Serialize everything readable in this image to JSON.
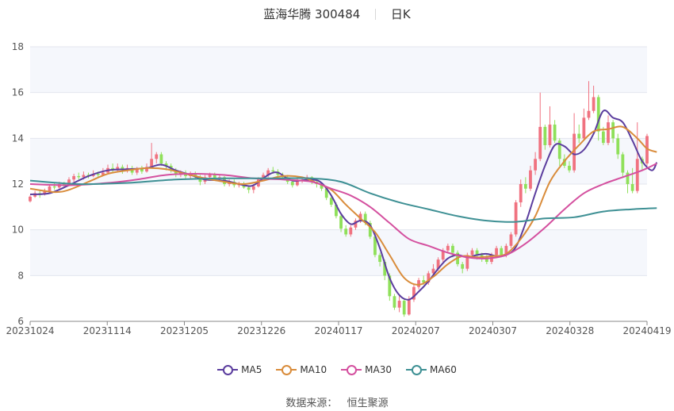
{
  "title": {
    "stock": "蓝海华腾 300484",
    "period": "日K"
  },
  "source": {
    "label": "数据来源：",
    "value": "恒生聚源"
  },
  "chart_data": {
    "type": "candlestick",
    "ylim": [
      6,
      18
    ],
    "yticks": [
      6,
      8,
      10,
      12,
      14,
      16,
      18
    ],
    "xticks": [
      "20231024",
      "20231114",
      "20231205",
      "20231226",
      "20240117",
      "20240207",
      "20240307",
      "20240328",
      "20240419"
    ],
    "grid": "horizontal",
    "legend_position": "bottom",
    "colors": {
      "up": "#f07280",
      "down": "#8fe05a",
      "ma5": "#5b3d9e",
      "ma10": "#d98c3b",
      "ma30": "#d4509f",
      "ma60": "#3e9094"
    },
    "candles": [
      [
        11.25,
        11.45,
        11.5,
        11.2
      ],
      [
        11.45,
        11.6,
        11.7,
        11.4
      ],
      [
        11.6,
        11.55,
        11.75,
        11.4
      ],
      [
        11.55,
        11.7,
        11.8,
        11.5
      ],
      [
        11.7,
        11.9,
        12.0,
        11.65
      ],
      [
        11.9,
        11.85,
        12.05,
        11.75
      ],
      [
        11.85,
        12.0,
        12.1,
        11.8
      ],
      [
        12.0,
        11.95,
        12.1,
        11.85
      ],
      [
        11.95,
        12.2,
        12.3,
        11.9
      ],
      [
        12.2,
        12.35,
        12.45,
        12.1
      ],
      [
        12.35,
        12.3,
        12.5,
        12.2
      ],
      [
        12.3,
        12.4,
        12.55,
        12.2
      ],
      [
        12.4,
        12.35,
        12.5,
        12.25
      ],
      [
        12.35,
        12.45,
        12.6,
        12.3
      ],
      [
        12.45,
        12.4,
        12.55,
        12.3
      ],
      [
        12.4,
        12.5,
        12.7,
        12.35
      ],
      [
        12.5,
        12.7,
        12.85,
        12.45
      ],
      [
        12.7,
        12.6,
        12.9,
        12.5
      ],
      [
        12.6,
        12.75,
        12.9,
        12.55
      ],
      [
        12.75,
        12.6,
        12.85,
        12.45
      ],
      [
        12.6,
        12.7,
        12.85,
        12.5
      ],
      [
        12.7,
        12.5,
        12.8,
        12.4
      ],
      [
        12.5,
        12.65,
        12.75,
        12.4
      ],
      [
        12.65,
        12.55,
        12.8,
        12.45
      ],
      [
        12.55,
        12.75,
        12.9,
        12.5
      ],
      [
        12.75,
        13.1,
        13.8,
        12.7
      ],
      [
        13.1,
        13.3,
        13.4,
        12.9
      ],
      [
        13.3,
        12.9,
        13.4,
        12.8
      ],
      [
        12.9,
        12.8,
        13.0,
        12.6
      ],
      [
        12.8,
        12.6,
        12.9,
        12.5
      ],
      [
        12.6,
        12.4,
        12.7,
        12.3
      ],
      [
        12.4,
        12.5,
        12.6,
        12.3
      ],
      [
        12.5,
        12.35,
        12.6,
        12.2
      ],
      [
        12.35,
        12.45,
        12.55,
        12.25
      ],
      [
        12.45,
        12.3,
        12.55,
        12.2
      ],
      [
        12.3,
        12.1,
        12.4,
        11.95
      ],
      [
        12.1,
        12.3,
        12.4,
        12.0
      ],
      [
        12.3,
        12.4,
        12.5,
        12.2
      ],
      [
        12.4,
        12.25,
        12.5,
        12.15
      ],
      [
        12.25,
        12.3,
        12.4,
        12.1
      ],
      [
        12.3,
        12.0,
        12.35,
        11.9
      ],
      [
        12.0,
        12.1,
        12.2,
        11.9
      ],
      [
        12.1,
        11.95,
        12.2,
        11.85
      ],
      [
        11.95,
        12.0,
        12.1,
        11.85
      ],
      [
        12.0,
        11.85,
        12.1,
        11.8
      ],
      [
        11.85,
        11.75,
        11.95,
        11.6
      ],
      [
        11.75,
        11.9,
        12.0,
        11.6
      ],
      [
        11.9,
        12.2,
        12.3,
        11.85
      ],
      [
        12.2,
        12.4,
        12.5,
        12.15
      ],
      [
        12.4,
        12.6,
        12.7,
        12.3
      ],
      [
        12.6,
        12.55,
        12.75,
        12.45
      ],
      [
        12.55,
        12.4,
        12.65,
        12.3
      ],
      [
        12.4,
        12.3,
        12.5,
        12.2
      ],
      [
        12.3,
        12.1,
        12.4,
        12.0
      ],
      [
        12.1,
        11.95,
        12.2,
        11.85
      ],
      [
        11.95,
        12.15,
        12.25,
        11.9
      ],
      [
        12.15,
        12.2,
        12.3,
        12.05
      ],
      [
        12.2,
        12.3,
        12.4,
        12.1
      ],
      [
        12.3,
        12.1,
        12.35,
        12.0
      ],
      [
        12.1,
        12.0,
        12.2,
        11.85
      ],
      [
        12.0,
        11.8,
        12.05,
        11.7
      ],
      [
        11.8,
        11.4,
        11.85,
        11.3
      ],
      [
        11.4,
        11.1,
        11.5,
        11.0
      ],
      [
        11.1,
        10.6,
        11.2,
        10.5
      ],
      [
        10.6,
        10.05,
        10.7,
        9.9
      ],
      [
        10.05,
        9.8,
        10.2,
        9.7
      ],
      [
        9.8,
        10.1,
        10.2,
        9.7
      ],
      [
        10.1,
        10.4,
        10.5,
        10.0
      ],
      [
        10.4,
        10.7,
        10.8,
        10.3
      ],
      [
        10.7,
        10.3,
        10.8,
        10.2
      ],
      [
        10.3,
        9.7,
        10.4,
        9.6
      ],
      [
        9.7,
        8.9,
        9.8,
        8.8
      ],
      [
        8.9,
        8.6,
        9.0,
        8.4
      ],
      [
        8.6,
        8.0,
        8.7,
        7.8
      ],
      [
        8.0,
        7.1,
        8.1,
        6.9
      ],
      [
        7.1,
        6.6,
        7.2,
        6.5
      ],
      [
        6.6,
        6.9,
        7.1,
        6.4
      ],
      [
        6.9,
        6.3,
        7.0,
        6.2
      ],
      [
        6.3,
        6.95,
        7.1,
        6.25
      ],
      [
        6.95,
        7.5,
        7.6,
        6.85
      ],
      [
        7.5,
        7.8,
        7.9,
        7.4
      ],
      [
        7.8,
        7.7,
        8.0,
        7.6
      ],
      [
        7.7,
        8.1,
        8.2,
        7.6
      ],
      [
        8.1,
        8.3,
        8.5,
        8.0
      ],
      [
        8.3,
        8.7,
        8.8,
        8.2
      ],
      [
        8.7,
        9.1,
        9.2,
        8.6
      ],
      [
        9.1,
        9.3,
        9.4,
        9.0
      ],
      [
        9.3,
        9.0,
        9.4,
        8.8
      ],
      [
        9.0,
        8.5,
        9.1,
        8.4
      ],
      [
        8.5,
        8.3,
        8.6,
        8.1
      ],
      [
        8.3,
        8.9,
        9.0,
        8.2
      ],
      [
        8.9,
        9.1,
        9.2,
        8.8
      ],
      [
        9.1,
        8.9,
        9.2,
        8.7
      ],
      [
        8.9,
        8.8,
        9.0,
        8.6
      ],
      [
        8.8,
        8.6,
        8.9,
        8.5
      ],
      [
        8.6,
        8.9,
        9.0,
        8.5
      ],
      [
        8.9,
        9.2,
        9.3,
        8.8
      ],
      [
        9.2,
        8.9,
        9.3,
        8.8
      ],
      [
        8.9,
        9.3,
        9.4,
        8.8
      ],
      [
        9.3,
        9.8,
        9.9,
        9.2
      ],
      [
        9.8,
        11.2,
        11.3,
        9.7
      ],
      [
        11.2,
        12.0,
        12.2,
        11.0
      ],
      [
        12.0,
        11.8,
        12.3,
        11.6
      ],
      [
        11.8,
        12.6,
        12.8,
        11.7
      ],
      [
        12.6,
        13.1,
        13.4,
        12.4
      ],
      [
        13.1,
        14.5,
        16.0,
        13.0
      ],
      [
        14.5,
        13.7,
        14.6,
        13.5
      ],
      [
        13.7,
        14.6,
        15.4,
        13.6
      ],
      [
        14.6,
        13.9,
        14.8,
        13.8
      ],
      [
        13.9,
        13.1,
        14.0,
        12.8
      ],
      [
        13.1,
        12.8,
        13.3,
        12.7
      ],
      [
        12.8,
        12.6,
        13.0,
        12.5
      ],
      [
        12.6,
        14.2,
        15.1,
        12.5
      ],
      [
        14.2,
        14.0,
        14.6,
        13.8
      ],
      [
        14.0,
        14.9,
        15.3,
        13.9
      ],
      [
        14.9,
        15.2,
        16.5,
        14.8
      ],
      [
        15.2,
        15.8,
        16.3,
        15.1
      ],
      [
        15.8,
        14.3,
        15.9,
        13.9
      ],
      [
        14.3,
        13.8,
        14.5,
        13.7
      ],
      [
        13.8,
        14.7,
        15.0,
        13.7
      ],
      [
        14.7,
        14.0,
        14.8,
        13.8
      ],
      [
        14.0,
        13.3,
        14.2,
        13.1
      ],
      [
        13.3,
        12.5,
        13.4,
        12.3
      ],
      [
        12.5,
        12.0,
        12.6,
        11.6
      ],
      [
        12.0,
        11.7,
        12.7,
        11.6
      ],
      [
        11.7,
        13.1,
        14.7,
        11.6
      ],
      [
        13.1,
        12.9,
        13.2,
        12.6
      ],
      [
        12.9,
        14.1,
        14.2,
        12.8
      ]
    ],
    "ma": [
      {
        "name": "MA5",
        "color": "#5b3d9e",
        "values": [
          [
            0,
            11.55
          ],
          [
            4,
            11.6
          ],
          [
            8,
            11.95
          ],
          [
            12,
            12.35
          ],
          [
            16,
            12.6
          ],
          [
            20,
            12.65
          ],
          [
            24,
            12.7
          ],
          [
            27,
            12.85
          ],
          [
            30,
            12.6
          ],
          [
            33,
            12.4
          ],
          [
            36,
            12.2
          ],
          [
            40,
            12.15
          ],
          [
            44,
            11.95
          ],
          [
            46,
            11.95
          ],
          [
            49,
            12.4
          ],
          [
            51,
            12.5
          ],
          [
            54,
            12.15
          ],
          [
            58,
            12.2
          ],
          [
            60,
            12.05
          ],
          [
            62,
            11.5
          ],
          [
            64,
            10.7
          ],
          [
            66,
            10.25
          ],
          [
            68,
            10.4
          ],
          [
            70,
            10.2
          ],
          [
            72,
            9.2
          ],
          [
            74,
            7.9
          ],
          [
            76,
            7.15
          ],
          [
            78,
            6.95
          ],
          [
            80,
            7.3
          ],
          [
            82,
            7.75
          ],
          [
            84,
            8.3
          ],
          [
            86,
            8.75
          ],
          [
            88,
            8.9
          ],
          [
            90,
            8.8
          ],
          [
            92,
            8.9
          ],
          [
            94,
            8.95
          ],
          [
            96,
            8.85
          ],
          [
            98,
            8.9
          ],
          [
            100,
            9.25
          ],
          [
            102,
            10.3
          ],
          [
            104,
            11.6
          ],
          [
            106,
            12.8
          ],
          [
            108,
            13.7
          ],
          [
            110,
            13.65
          ],
          [
            112,
            13.3
          ],
          [
            114,
            13.5
          ],
          [
            116,
            14.2
          ],
          [
            118,
            15.2
          ],
          [
            120,
            14.9
          ],
          [
            122,
            14.7
          ],
          [
            124,
            13.9
          ],
          [
            126,
            13.0
          ],
          [
            128,
            12.6
          ],
          [
            129,
            12.95
          ]
        ]
      },
      {
        "name": "MA10",
        "color": "#d98c3b",
        "values": [
          [
            0,
            11.8
          ],
          [
            5,
            11.65
          ],
          [
            8,
            11.75
          ],
          [
            12,
            12.1
          ],
          [
            16,
            12.45
          ],
          [
            20,
            12.6
          ],
          [
            24,
            12.7
          ],
          [
            28,
            12.65
          ],
          [
            32,
            12.45
          ],
          [
            36,
            12.25
          ],
          [
            40,
            12.1
          ],
          [
            44,
            12.0
          ],
          [
            48,
            12.15
          ],
          [
            52,
            12.35
          ],
          [
            56,
            12.3
          ],
          [
            59,
            12.05
          ],
          [
            62,
            11.75
          ],
          [
            65,
            11.1
          ],
          [
            68,
            10.5
          ],
          [
            71,
            9.9
          ],
          [
            74,
            8.9
          ],
          [
            77,
            7.9
          ],
          [
            80,
            7.6
          ],
          [
            83,
            7.95
          ],
          [
            86,
            8.5
          ],
          [
            89,
            8.85
          ],
          [
            92,
            8.8
          ],
          [
            95,
            8.85
          ],
          [
            98,
            8.95
          ],
          [
            101,
            9.6
          ],
          [
            104,
            10.6
          ],
          [
            107,
            12.1
          ],
          [
            110,
            13.0
          ],
          [
            113,
            13.7
          ],
          [
            116,
            14.3
          ],
          [
            119,
            14.4
          ],
          [
            122,
            14.5
          ],
          [
            125,
            14.0
          ],
          [
            127,
            13.55
          ],
          [
            129,
            13.4
          ]
        ]
      },
      {
        "name": "MA30",
        "color": "#d4509f",
        "values": [
          [
            0,
            12.0
          ],
          [
            8,
            11.95
          ],
          [
            16,
            12.05
          ],
          [
            22,
            12.2
          ],
          [
            28,
            12.4
          ],
          [
            34,
            12.45
          ],
          [
            40,
            12.4
          ],
          [
            46,
            12.25
          ],
          [
            52,
            12.2
          ],
          [
            58,
            12.1
          ],
          [
            62,
            11.8
          ],
          [
            66,
            11.5
          ],
          [
            70,
            11.0
          ],
          [
            74,
            10.3
          ],
          [
            78,
            9.6
          ],
          [
            82,
            9.3
          ],
          [
            86,
            9.0
          ],
          [
            90,
            8.8
          ],
          [
            94,
            8.75
          ],
          [
            98,
            8.9
          ],
          [
            102,
            9.4
          ],
          [
            106,
            10.1
          ],
          [
            110,
            10.9
          ],
          [
            114,
            11.6
          ],
          [
            118,
            12.0
          ],
          [
            122,
            12.3
          ],
          [
            126,
            12.6
          ],
          [
            129,
            12.9
          ]
        ]
      },
      {
        "name": "MA60",
        "color": "#3e9094",
        "values": [
          [
            0,
            12.15
          ],
          [
            10,
            12.0
          ],
          [
            20,
            12.05
          ],
          [
            30,
            12.2
          ],
          [
            40,
            12.25
          ],
          [
            50,
            12.25
          ],
          [
            58,
            12.25
          ],
          [
            64,
            12.1
          ],
          [
            70,
            11.6
          ],
          [
            76,
            11.2
          ],
          [
            82,
            10.9
          ],
          [
            88,
            10.6
          ],
          [
            94,
            10.4
          ],
          [
            100,
            10.35
          ],
          [
            106,
            10.5
          ],
          [
            112,
            10.55
          ],
          [
            118,
            10.8
          ],
          [
            124,
            10.9
          ],
          [
            129,
            10.95
          ]
        ]
      }
    ]
  }
}
